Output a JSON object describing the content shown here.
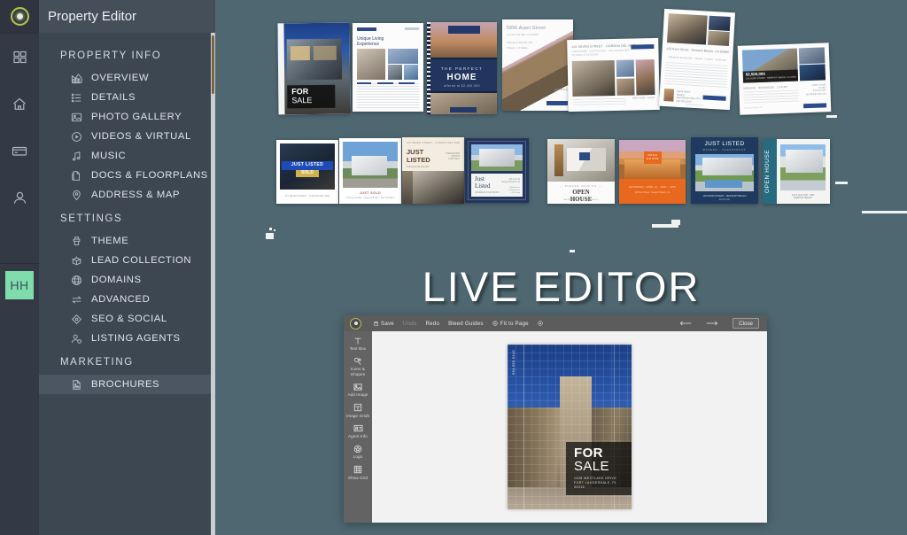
{
  "app": {
    "title": "Property Editor",
    "background_color": "#4e6771",
    "sidebar_color": "#3d4752",
    "rail_color": "#343a45",
    "accent_color": "#7fdcad"
  },
  "rail": {
    "logo_name": "app-logo",
    "items": [
      {
        "icon": "dashboard-grid-icon",
        "label": "Dashboard"
      },
      {
        "icon": "home-icon",
        "label": "Home"
      },
      {
        "icon": "card-icon",
        "label": "Billing"
      },
      {
        "icon": "person-icon",
        "label": "Account"
      }
    ],
    "avatar": {
      "initials": "HH",
      "color": "#7fdcad"
    }
  },
  "sidebar": {
    "header_title": "Property Editor",
    "groups": [
      {
        "title": "PROPERTY INFO",
        "items": [
          {
            "label": "OVERVIEW",
            "icon": "chart-overview-icon",
            "active": false
          },
          {
            "label": "DETAILS",
            "icon": "list-details-icon",
            "active": false
          },
          {
            "label": "PHOTO GALLERY",
            "icon": "photo-icon",
            "active": false
          },
          {
            "label": "VIDEOS & VIRTUAL",
            "icon": "play-circle-icon",
            "active": false
          },
          {
            "label": "MUSIC",
            "icon": "music-note-icon",
            "active": false
          },
          {
            "label": "DOCS & FLOORPLANS",
            "icon": "document-icon",
            "active": false
          },
          {
            "label": "ADDRESS & MAP",
            "icon": "map-pin-icon",
            "active": false
          }
        ]
      },
      {
        "title": "SETTINGS",
        "items": [
          {
            "label": "THEME",
            "icon": "paint-brush-icon",
            "active": false
          },
          {
            "label": "LEAD COLLECTION",
            "icon": "box-collect-icon",
            "active": false
          },
          {
            "label": "DOMAINS",
            "icon": "globe-icon",
            "active": false
          },
          {
            "label": "ADVANCED",
            "icon": "arrows-exchange-icon",
            "active": false
          },
          {
            "label": "SEO & SOCIAL",
            "icon": "diamond-target-icon",
            "active": false
          },
          {
            "label": "LISTING AGENTS",
            "icon": "person-gear-icon",
            "active": false
          }
        ]
      },
      {
        "title": "MARKETING",
        "items": [
          {
            "label": "BROCHURES",
            "icon": "brochure-page-icon",
            "active": true
          }
        ]
      }
    ]
  },
  "main": {
    "live_editor_title": "LIVE EDITOR",
    "brochure_rows": [
      {
        "name": "flyer-row",
        "items": [
          {
            "name": "flyer-for-sale",
            "headline": "FOR SALE",
            "style": "photo-portrait"
          },
          {
            "name": "flyer-unique-living",
            "headline": "Unique Living Experience",
            "style": "white-grid"
          },
          {
            "name": "flyer-perfect-home",
            "headline": "THE PERFECT HOME",
            "style": "navy-band"
          },
          {
            "name": "flyer-arpet-street",
            "headline": "5896 Arpet Street",
            "style": "diagonal-white"
          },
          {
            "name": "flyer-corona-del-mar",
            "headline": "115 SEVEN STREET - CORONA DEL MAR",
            "style": "landscape-white"
          },
          {
            "name": "flyer-newport-beach",
            "headline": "125 Kerri Street - Newport Beach, CA 92660",
            "style": "portrait-white"
          },
          {
            "name": "flyer-price-listing",
            "headline": "$2,500,000",
            "style": "landscape-photo"
          }
        ]
      },
      {
        "name": "social-row",
        "items": [
          {
            "name": "social-just-listed-sold",
            "headline": "JUST LISTED SOLD",
            "style": "night-photo"
          },
          {
            "name": "social-just-sold",
            "headline": "JUST SOLD",
            "style": "polaroid"
          },
          {
            "name": "social-just-listed-cream",
            "headline": "JUST LISTED",
            "style": "cream-split"
          },
          {
            "name": "social-just-listed-navy",
            "headline": "Just Listed",
            "style": "navy-frame"
          },
          {
            "name": "social-open-house-white",
            "headline": "OPEN HOUSE",
            "style": "white-bottom"
          },
          {
            "name": "social-open-house-orange",
            "headline": "OPEN HOUSE",
            "style": "orange"
          },
          {
            "name": "social-just-listed-blue",
            "headline": "JUST LISTED",
            "style": "blue-banner"
          },
          {
            "name": "social-open-house-teal",
            "headline": "OPEN HOUSE",
            "style": "teal-side"
          }
        ]
      }
    ]
  },
  "editor": {
    "toolbar": {
      "logo_name": "editor-logo",
      "buttons": [
        {
          "label": "Save",
          "icon": "save-disk-icon",
          "disabled": false
        },
        {
          "label": "Undo",
          "icon": "",
          "disabled": true
        },
        {
          "label": "Redo",
          "icon": "",
          "disabled": false
        },
        {
          "label": "Bleed Guides",
          "icon": "",
          "disabled": false
        },
        {
          "label": "Fit to Page",
          "icon": "fit-circle-icon",
          "disabled": false
        }
      ],
      "extra_icon": "settings-circle-icon",
      "prev_label": "Previous page",
      "next_label": "Next page",
      "close_label": "Close"
    },
    "tools": [
      {
        "label": "Text Box",
        "icon": "text-box-icon"
      },
      {
        "label": "Icons & Shapes",
        "icon": "shapes-icon"
      },
      {
        "label": "Add Image",
        "icon": "add-image-icon"
      },
      {
        "label": "Image Grids",
        "icon": "image-grid-icon"
      },
      {
        "label": "Agent Info",
        "icon": "agent-info-icon"
      },
      {
        "label": "Logo",
        "icon": "logo-badge-icon"
      },
      {
        "label": "Show Grid",
        "icon": "show-grid-icon"
      }
    ],
    "canvas": {
      "page_name": "brochure-page",
      "phone": "954.555.0142",
      "headline_top": "FOR",
      "headline_bottom": "SALE",
      "address_line1": "1408 WESTLAKE DRIVE",
      "address_line2": "FORT LAUDERDALE, FL 33316"
    }
  }
}
